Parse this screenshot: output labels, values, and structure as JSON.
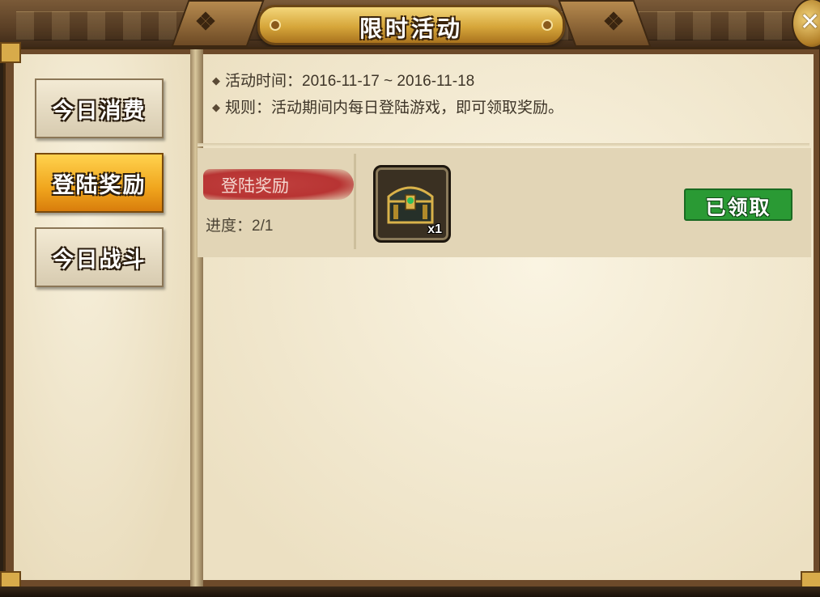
{
  "window": {
    "title": "限时活动"
  },
  "tabs": [
    {
      "label": "今日消费",
      "active": false
    },
    {
      "label": "登陆奖励",
      "active": true
    },
    {
      "label": "今日战斗",
      "active": false
    }
  ],
  "activity": {
    "time_line": "活动时间：2016-11-17 ~ 2016-11-18",
    "rule_line": "规则：活动期间内每日登陆游戏，即可领取奖励。"
  },
  "reward": {
    "name": "登陆奖励",
    "progress": "进度：2/1",
    "item_icon": "treasure-chest-icon",
    "item_quantity": "x1",
    "status_label": "已领取",
    "status_color": "#2a9a34"
  },
  "colors": {
    "active_tab": "#f0a51d",
    "title_plate": "#d6a63a"
  }
}
